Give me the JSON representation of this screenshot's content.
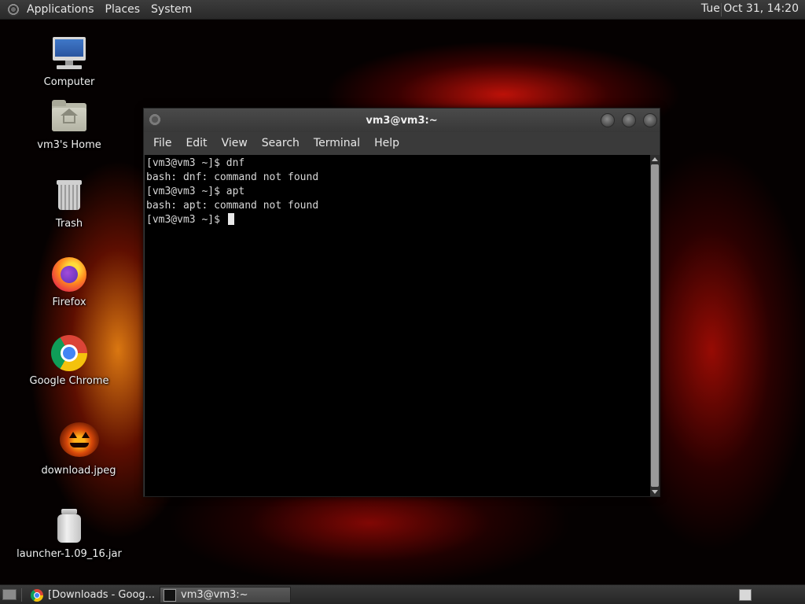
{
  "top_panel": {
    "menus": [
      "Applications",
      "Places",
      "System"
    ],
    "clock": "Tue Oct 31, 14:20"
  },
  "desktop_icons": [
    {
      "label": "Computer",
      "icon": "computer-icon"
    },
    {
      "label": "vm3's Home",
      "icon": "home-folder-icon"
    },
    {
      "label": "Trash",
      "icon": "trash-icon"
    },
    {
      "label": "Firefox",
      "icon": "firefox-icon"
    },
    {
      "label": "Google Chrome",
      "icon": "chrome-icon"
    },
    {
      "label": "download.jpeg",
      "icon": "image-file-icon"
    },
    {
      "label": "launcher-1.09_16.jar",
      "icon": "jar-file-icon"
    }
  ],
  "terminal": {
    "title": "vm3@vm3:~",
    "menu": [
      "File",
      "Edit",
      "View",
      "Search",
      "Terminal",
      "Help"
    ],
    "lines": [
      "[vm3@vm3 ~]$ dnf",
      "bash: dnf: command not found",
      "[vm3@vm3 ~]$ apt",
      "bash: apt: command not found",
      "[vm3@vm3 ~]$ "
    ]
  },
  "taskbar": {
    "tasks": [
      {
        "label": "[Downloads - Goog...",
        "icon": "chrome-icon",
        "active": false
      },
      {
        "label": "vm3@vm3:~",
        "icon": "terminal-icon",
        "active": true
      }
    ]
  }
}
